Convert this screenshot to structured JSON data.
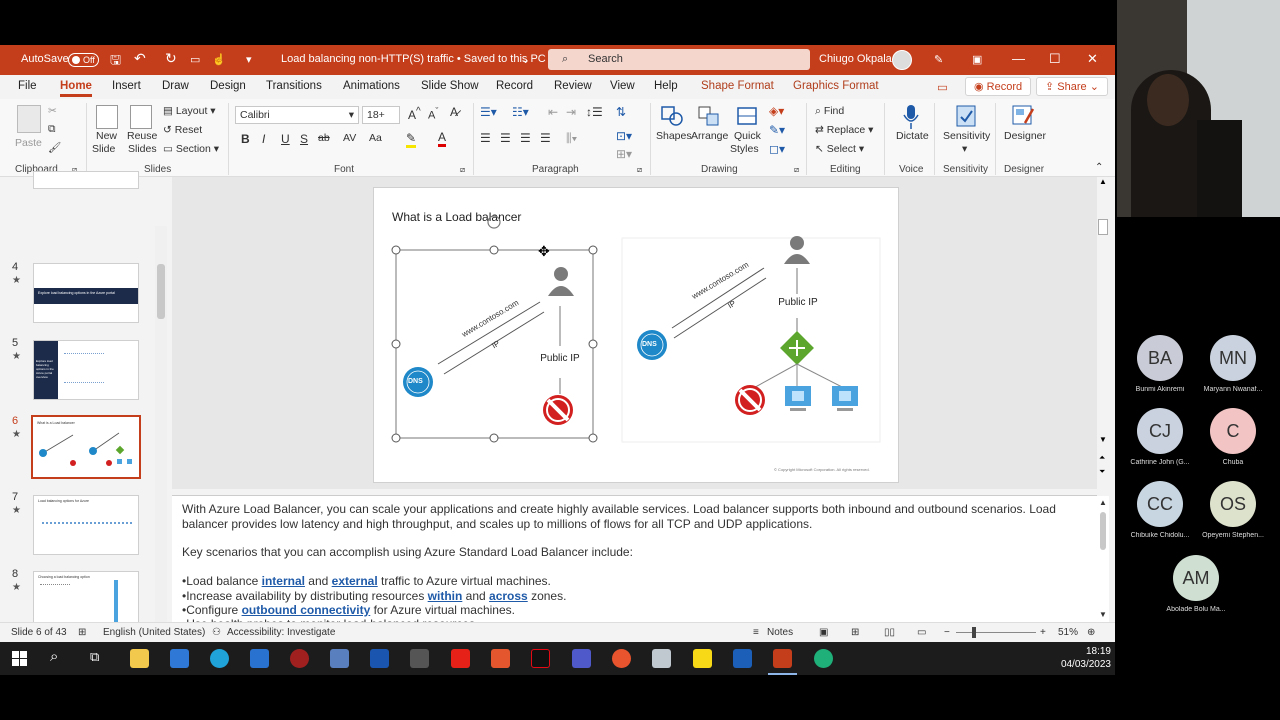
{
  "titlebar": {
    "autosave_label": "AutoSave",
    "autosave_state": "Off",
    "doc_title": "Load balancing non-HTTP(S) traffic • Saved to this PC",
    "search_placeholder": "Search",
    "user_name": "Chiugo Okpala"
  },
  "tabs": [
    "File",
    "Home",
    "Insert",
    "Draw",
    "Design",
    "Transitions",
    "Animations",
    "Slide Show",
    "Record",
    "Review",
    "View",
    "Help",
    "Shape Format",
    "Graphics Format"
  ],
  "tab_right": {
    "record": "Record",
    "share": "Share"
  },
  "ribbon": {
    "clipboard": {
      "paste": "Paste",
      "label": "Clipboard"
    },
    "slides": {
      "new_slide_1": "New",
      "new_slide_2": "Slide",
      "reuse_1": "Reuse",
      "reuse_2": "Slides",
      "layout": "Layout",
      "reset": "Reset",
      "section": "Section",
      "label": "Slides"
    },
    "font": {
      "name": "Calibri",
      "size": "18+",
      "label": "Font",
      "bold": "B",
      "italic": "I",
      "underline": "U",
      "strike": "ab",
      "case": "Aa"
    },
    "paragraph": {
      "label": "Paragraph"
    },
    "drawing": {
      "shapes": "Shapes",
      "arrange": "Arrange",
      "quick_1": "Quick",
      "quick_2": "Styles",
      "label": "Drawing"
    },
    "editing": {
      "find": "Find",
      "replace": "Replace",
      "select": "Select",
      "label": "Editing"
    },
    "voice": {
      "dictate": "Dictate",
      "label": "Voice"
    },
    "sensitivity": {
      "button": "Sensitivity",
      "label": "Sensitivity"
    },
    "designer": {
      "button": "Designer",
      "label": "Designer"
    }
  },
  "slide_thumbs": [
    {
      "num": "4",
      "title": "Explore load balancing options in the Azure portal"
    },
    {
      "num": "5",
      "title": "Explore load balancing options in the Azure portal overview"
    },
    {
      "num": "6",
      "title": "What is a Load balancer"
    },
    {
      "num": "7",
      "title": "Load balancing options for Azure"
    },
    {
      "num": "8",
      "title": "Choosing a load balancing option"
    },
    {
      "num": "9",
      "title": ""
    }
  ],
  "slide": {
    "title": "What is a Load balancer",
    "left": {
      "url": "www.contoso.com",
      "ip": "IP",
      "public_ip": "Public IP",
      "dns": "DNS"
    },
    "right": {
      "url": "www.contoso.com",
      "ip": "IP",
      "public_ip": "Public IP",
      "dns": "DNS"
    },
    "copyright": "© Copyright Microsoft Corporation. All rights reserved."
  },
  "notes": {
    "p1a": "With Azure Load Balancer, you can scale your applications and create highly available services. Load balancer supports both inbound and outbound scenarios. Load",
    "p1b": "balancer provides low latency and high throughput, and scales up to millions of flows for all TCP and UDP applications.",
    "p2": "Key scenarios that you can accomplish using Azure Standard Load Balancer include:",
    "b1_pre": "•Load balance ",
    "b1_k1": "internal",
    "b1_mid": " and ",
    "b1_k2": "external",
    "b1_post": " traffic to Azure virtual machines.",
    "b2_pre": "•Increase availability by distributing resources ",
    "b2_k1": "within",
    "b2_mid": " and ",
    "b2_k2": "across",
    "b2_post": " zones.",
    "b3_pre": "•Configure ",
    "b3_k1": "outbound connectivity",
    "b3_post": " for Azure virtual machines.",
    "b4": "•Use health probes to monitor load-balanced resources."
  },
  "status": {
    "slide_count": "Slide 6 of 43",
    "language": "English (United States)",
    "accessibility": "Accessibility: Investigate",
    "notes": "Notes",
    "zoom": "51%"
  },
  "clock": {
    "time": "18:19",
    "date": "04/03/2023"
  },
  "participants": [
    {
      "initials": "BA",
      "name": "Bunmi Akinremi",
      "color": "#c9ccd6"
    },
    {
      "initials": "MN",
      "name": "Maryann Nwanaf...",
      "color": "#c9d2de"
    },
    {
      "initials": "CJ",
      "name": "Cathrine John (G...",
      "color": "#c9d2de"
    },
    {
      "initials": "C",
      "name": "Chuba",
      "color": "#f2c4c4"
    },
    {
      "initials": "CC",
      "name": "Chibuike Chidolu...",
      "color": "#c8d6e2"
    },
    {
      "initials": "OS",
      "name": "Opeyemi Stephen...",
      "color": "#dde2cc"
    },
    {
      "initials": "AM",
      "name": "Abolade Bolu Ma...",
      "color": "#cfe0d2"
    }
  ],
  "colors": {
    "accent": "#c43e1c",
    "link": "#1f5aa8"
  }
}
